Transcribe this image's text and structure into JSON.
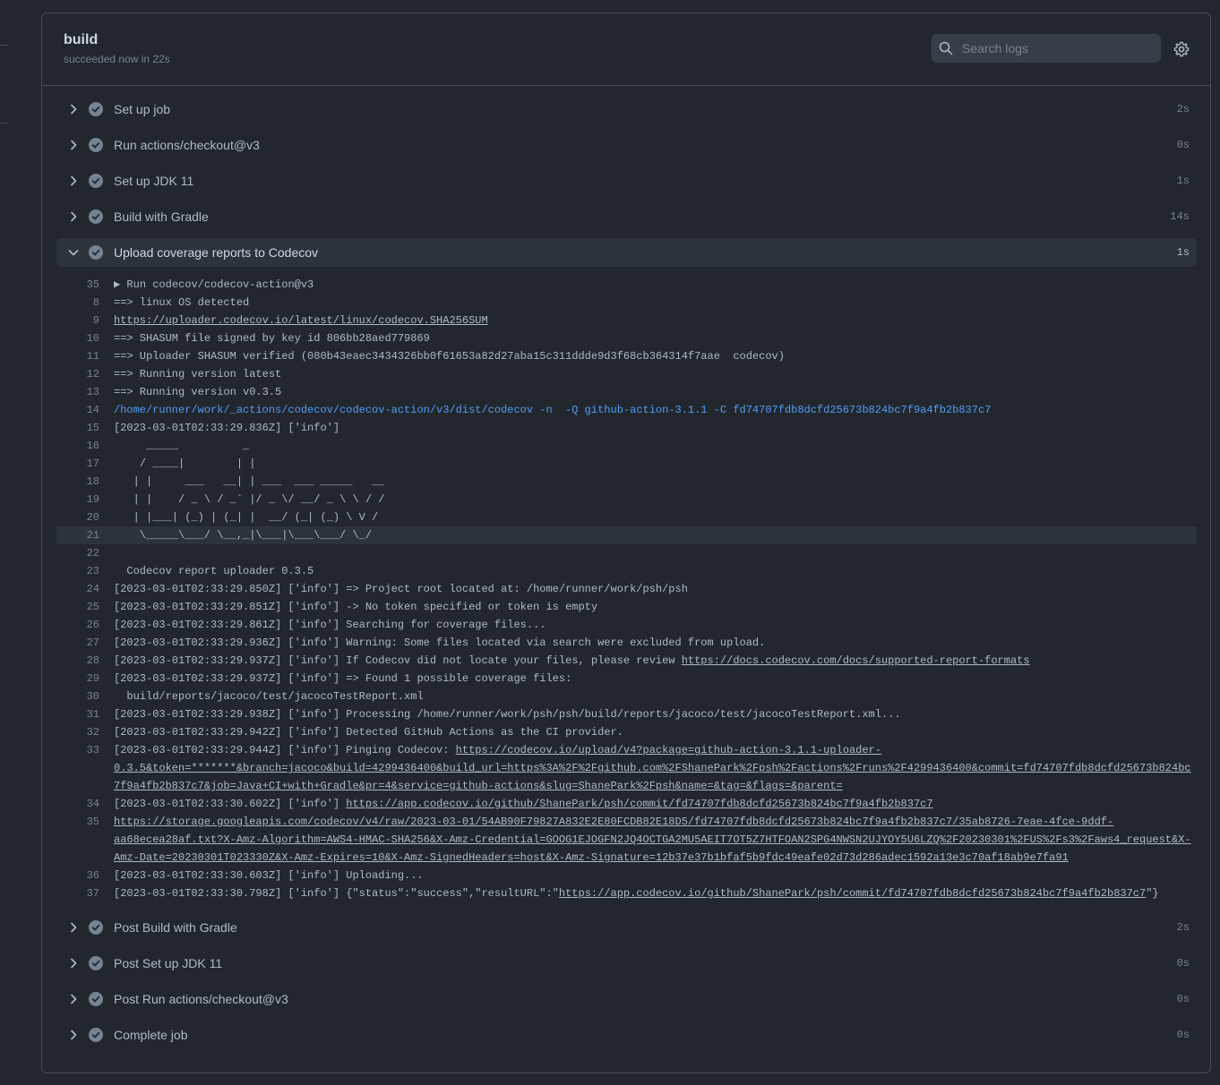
{
  "job": {
    "title": "build",
    "subtitle": "succeeded now in 22s",
    "search_placeholder": "Search logs"
  },
  "steps_before": [
    {
      "name": "Set up job",
      "duration": "2s"
    },
    {
      "name": "Run actions/checkout@v3",
      "duration": "0s"
    },
    {
      "name": "Set up JDK 11",
      "duration": "1s"
    },
    {
      "name": "Build with Gradle",
      "duration": "14s"
    }
  ],
  "expanded_step": {
    "name": "Upload coverage reports to Codecov",
    "duration": "1s"
  },
  "steps_after": [
    {
      "name": "Post Build with Gradle",
      "duration": "2s"
    },
    {
      "name": "Post Set up JDK 11",
      "duration": "0s"
    },
    {
      "name": "Post Run actions/checkout@v3",
      "duration": "0s"
    },
    {
      "name": "Complete job",
      "duration": "0s"
    }
  ],
  "log_lines": [
    {
      "n": "35",
      "text": "▶ Run codecov/codecov-action@v3"
    },
    {
      "n": "8",
      "text": "==> linux OS detected"
    },
    {
      "n": "9",
      "link": "https://uploader.codecov.io/latest/linux/codecov.SHA256SUM"
    },
    {
      "n": "10",
      "text": "==> SHASUM file signed by key id 806bb28aed779869"
    },
    {
      "n": "11",
      "text": "==> Uploader SHASUM verified (080b43eaec3434326bb0f61653a82d27aba15c311ddde9d3f68cb364314f7aae  codecov)"
    },
    {
      "n": "12",
      "text": "==> Running version latest"
    },
    {
      "n": "13",
      "text": "==> Running version v0.3.5"
    },
    {
      "n": "14",
      "text": "/home/runner/work/_actions/codecov/codecov-action/v3/dist/codecov -n  -Q github-action-3.1.1 -C fd74707fdb8dcfd25673b824bc7f9a4fb2b837c7",
      "blue": true
    },
    {
      "n": "15",
      "text": "[2023-03-01T02:33:29.836Z] ['info']"
    },
    {
      "n": "16",
      "text": "     _____          _"
    },
    {
      "n": "17",
      "text": "    / ____|        | |"
    },
    {
      "n": "18",
      "text": "   | |     ___   __| | ___  ___ _____   __"
    },
    {
      "n": "19",
      "text": "   | |    / _ \\ / _` |/ _ \\/ __/ _ \\ \\ / /"
    },
    {
      "n": "20",
      "text": "   | |___| (_) | (_| |  __/ (_| (_) \\ V /"
    },
    {
      "n": "21",
      "text": "    \\_____\\___/ \\__,_|\\___|\\___\\___/ \\_/",
      "hl": true
    },
    {
      "n": "22",
      "text": ""
    },
    {
      "n": "23",
      "text": "  Codecov report uploader 0.3.5"
    },
    {
      "n": "24",
      "text": "[2023-03-01T02:33:29.850Z] ['info'] => Project root located at: /home/runner/work/psh/psh"
    },
    {
      "n": "25",
      "text": "[2023-03-01T02:33:29.851Z] ['info'] -> No token specified or token is empty"
    },
    {
      "n": "26",
      "text": "[2023-03-01T02:33:29.861Z] ['info'] Searching for coverage files..."
    },
    {
      "n": "27",
      "text": "[2023-03-01T02:33:29.936Z] ['info'] Warning: Some files located via search were excluded from upload."
    },
    {
      "n": "28",
      "text": "[2023-03-01T02:33:29.937Z] ['info'] If Codecov did not locate your files, please review ",
      "link": "https://docs.codecov.com/docs/supported-report-formats"
    },
    {
      "n": "29",
      "text": "[2023-03-01T02:33:29.937Z] ['info'] => Found 1 possible coverage files:"
    },
    {
      "n": "30",
      "text": "  build/reports/jacoco/test/jacocoTestReport.xml"
    },
    {
      "n": "31",
      "text": "[2023-03-01T02:33:29.938Z] ['info'] Processing /home/runner/work/psh/psh/build/reports/jacoco/test/jacocoTestReport.xml..."
    },
    {
      "n": "32",
      "text": "[2023-03-01T02:33:29.942Z] ['info'] Detected GitHub Actions as the CI provider."
    },
    {
      "n": "33",
      "text": "[2023-03-01T02:33:29.944Z] ['info'] Pinging Codecov: ",
      "link": "https://codecov.io/upload/v4?package=github-action-3.1.1-uploader-",
      "cont": [
        "0.3.5&token=*******&branch=jacoco&build=4299436400&build_url=https%3A%2F%2Fgithub.com%2FShanePark%2Fpsh%2Factions%2Fruns%2F4299436400&commit=fd74707fdb8dcfd25673b824bc",
        "7f9a4fb2b837c7&job=Java+CI+with+Gradle&pr=4&service=github-actions&slug=ShanePark%2Fpsh&name=&tag=&flags=&parent="
      ]
    },
    {
      "n": "34",
      "text": "[2023-03-01T02:33:30.602Z] ['info'] ",
      "link": "https://app.codecov.io/github/ShanePark/psh/commit/fd74707fdb8dcfd25673b824bc7f9a4fb2b837c7"
    },
    {
      "n": "35",
      "link": "https://storage.googleapis.com/codecov/v4/raw/2023-03-01/54AB90F79827A832E2E80FCDB82E18D5/fd74707fdb8dcfd25673b824bc7f9a4fb2b837c7/35ab8726-7eae-4fce-9ddf-",
      "cont": [
        "aa68ecea28af.txt?X-Amz-Algorithm=AWS4-HMAC-SHA256&X-Amz-Credential=GOOG1EJOGFN2JQ4OCTGA2MU5AEIT7OT5Z7HTFOAN2SPG4NWSN2UJYOY5U6LZQ%2F20230301%2FUS%2Fs3%2Faws4_request&X-",
        "Amz-Date=20230301T023330Z&X-Amz-Expires=10&X-Amz-SignedHeaders=host&X-Amz-Signature=12b37e37b1bfaf5b9fdc49eafe02d73d286adec1592a13e3c70af18ab9e7fa91"
      ]
    },
    {
      "n": "36",
      "text": "[2023-03-01T02:33:30.603Z] ['info'] Uploading..."
    },
    {
      "n": "37",
      "text": "[2023-03-01T02:33:30.798Z] ['info'] {\"status\":\"success\",\"resultURL\":\"",
      "link": "https://app.codecov.io/github/ShanePark/psh/commit/fd74707fdb8dcfd25673b824bc7f9a4fb2b837c7",
      "after": "\"}"
    }
  ],
  "icons": {
    "search": "search-icon",
    "settings": "gear-icon",
    "collapsed": "chevron-right-icon",
    "expanded": "chevron-down-icon",
    "status": "check-circle-icon"
  },
  "colors": {
    "background": "#22272e",
    "success_check": "#768390",
    "command_text": "#539bf5"
  }
}
